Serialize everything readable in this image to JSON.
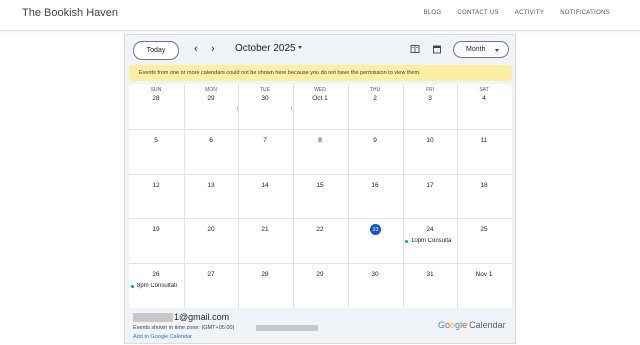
{
  "site": {
    "title": "The Bookish Haven",
    "nav": [
      "BLOG",
      "CONTACT US",
      "ACTIVITY",
      "NOTIFICATIONS"
    ]
  },
  "calendar": {
    "today_label": "Today",
    "month_label": "October 2025",
    "view_label": "Month",
    "warning": "Events from one or more calendars could not be shown here because you do not have the permission to view them.",
    "weekdays": [
      "SUN",
      "MON",
      "TUE",
      "WED",
      "THU",
      "FRI",
      "SAT"
    ],
    "weeks": [
      [
        "28",
        "29",
        "30",
        "Oct 1",
        "2",
        "3",
        "4"
      ],
      [
        "5",
        "6",
        "7",
        "8",
        "9",
        "10",
        "11"
      ],
      [
        "12",
        "13",
        "14",
        "15",
        "16",
        "17",
        "18"
      ],
      [
        "19",
        "20",
        "21",
        "22",
        "23",
        "24",
        "25"
      ],
      [
        "26",
        "27",
        "28",
        "29",
        "30",
        "31",
        "Nov 1"
      ]
    ],
    "today_date": "23",
    "events": [
      {
        "week": 3,
        "day": 5,
        "text": "10pm Consulta"
      },
      {
        "week": 4,
        "day": 0,
        "text": "8pm Consultati"
      }
    ],
    "accent": "#0b57d0",
    "event_dot_color": "#039be5",
    "warning_bg": "#fcefa4"
  },
  "footer": {
    "email_suffix": "1@gmail.com",
    "timezone_text": "Events shown in time zone: (GMT+05:00)",
    "add_link": "Add to Google Calendar",
    "brand_google": "Google",
    "brand_calendar": "Calendar"
  }
}
